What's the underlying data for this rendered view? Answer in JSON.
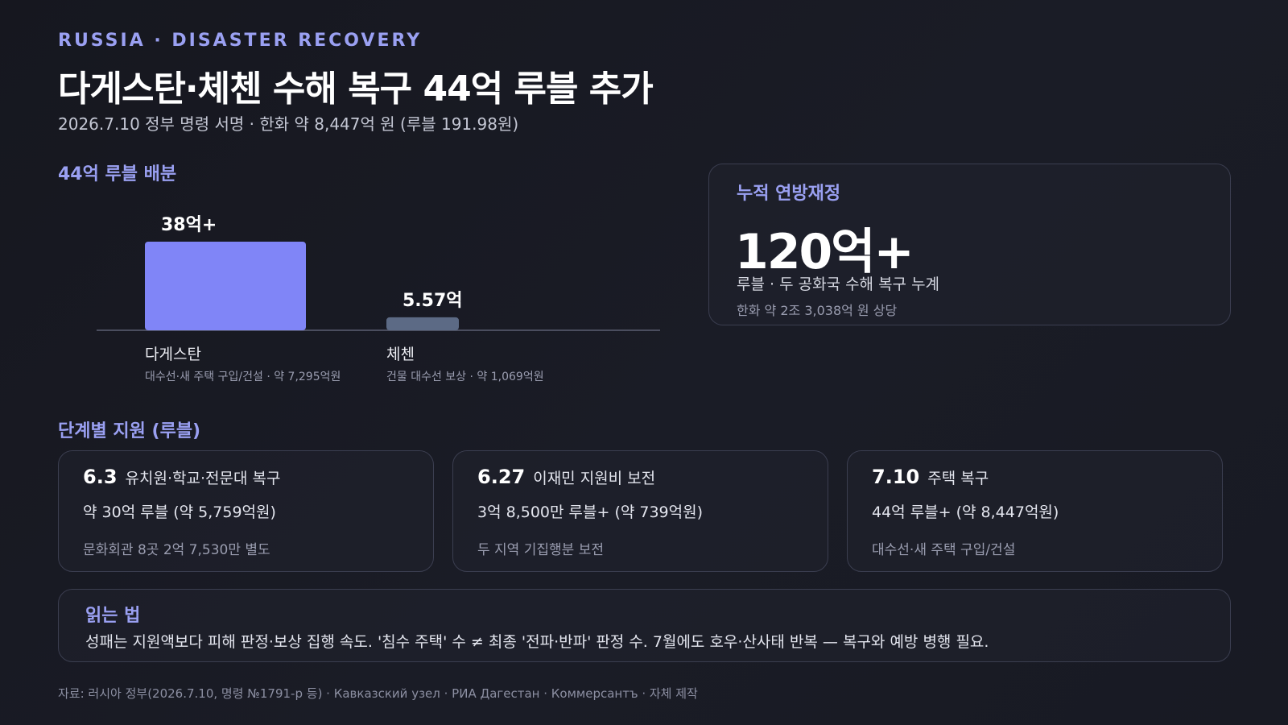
{
  "header": {
    "eyebrow": "RUSSIA · DISASTER RECOVERY",
    "title": "다게스탄·체첸 수해 복구 44억 루블 추가",
    "subtitle": "2026.7.10 정부 명령 서명 · 한화 약 8,447억 원 (루블 191.98원)"
  },
  "colors": {
    "accent": "#9aa0f2",
    "bar_dagestan": "#8085f7",
    "bar_chechnya": "#5c6a85",
    "baseline": "#4a4d5e"
  },
  "allocation_heading": "44억 루블 배분",
  "chart_data": {
    "type": "bar",
    "title": "44억 루블 배분",
    "unit": "억 루블",
    "categories": [
      "다게스탄",
      "체첸"
    ],
    "values": [
      38,
      5.57
    ],
    "value_labels": [
      "38억+",
      "5.57억"
    ],
    "category_notes": [
      "대수선·새 주택 구입/건설 · 약 7,295억원",
      "건물 대수선 보상 · 약 1,069억원"
    ],
    "bar_colors": [
      "#8085f7",
      "#5c6a85"
    ],
    "ylim": [
      0,
      38
    ],
    "grid": false
  },
  "kpi": {
    "label": "누적 연방재정",
    "value": "120억+",
    "desc": "루블 · 두 공화국 수해 복구 누계",
    "sub": "한화 약 2조 3,038억 원 상당"
  },
  "stages_heading": "단계별 지원 (루블)",
  "stages": [
    {
      "date": "6.3",
      "name": "유치원·학교·전문대 복구",
      "amount": "약 30억 루블 (약 5,759억원)",
      "note": "문화회관 8곳 2억 7,530만 별도"
    },
    {
      "date": "6.27",
      "name": "이재민 지원비 보전",
      "amount": "3억 8,500만 루블+ (약 739억원)",
      "note": "두 지역 기집행분 보전"
    },
    {
      "date": "7.10",
      "name": "주택 복구",
      "amount": "44억 루블+ (약 8,447억원)",
      "note": "대수선·새 주택 구입/건설"
    }
  ],
  "reading": {
    "title": "읽는 법",
    "text": "성패는 지원액보다 피해 판정·보상 집행 속도. '침수 주택' 수 ≠ 최종 '전파·반파' 판정 수. 7월에도 호우·산사태 반복 — 복구와 예방 병행 필요."
  },
  "source": "자료: 러시아 정부(2026.7.10, 명령 №1791-р 등) · Кавказский узел · РИА Дагестан · Коммерсантъ · 자체 제작"
}
